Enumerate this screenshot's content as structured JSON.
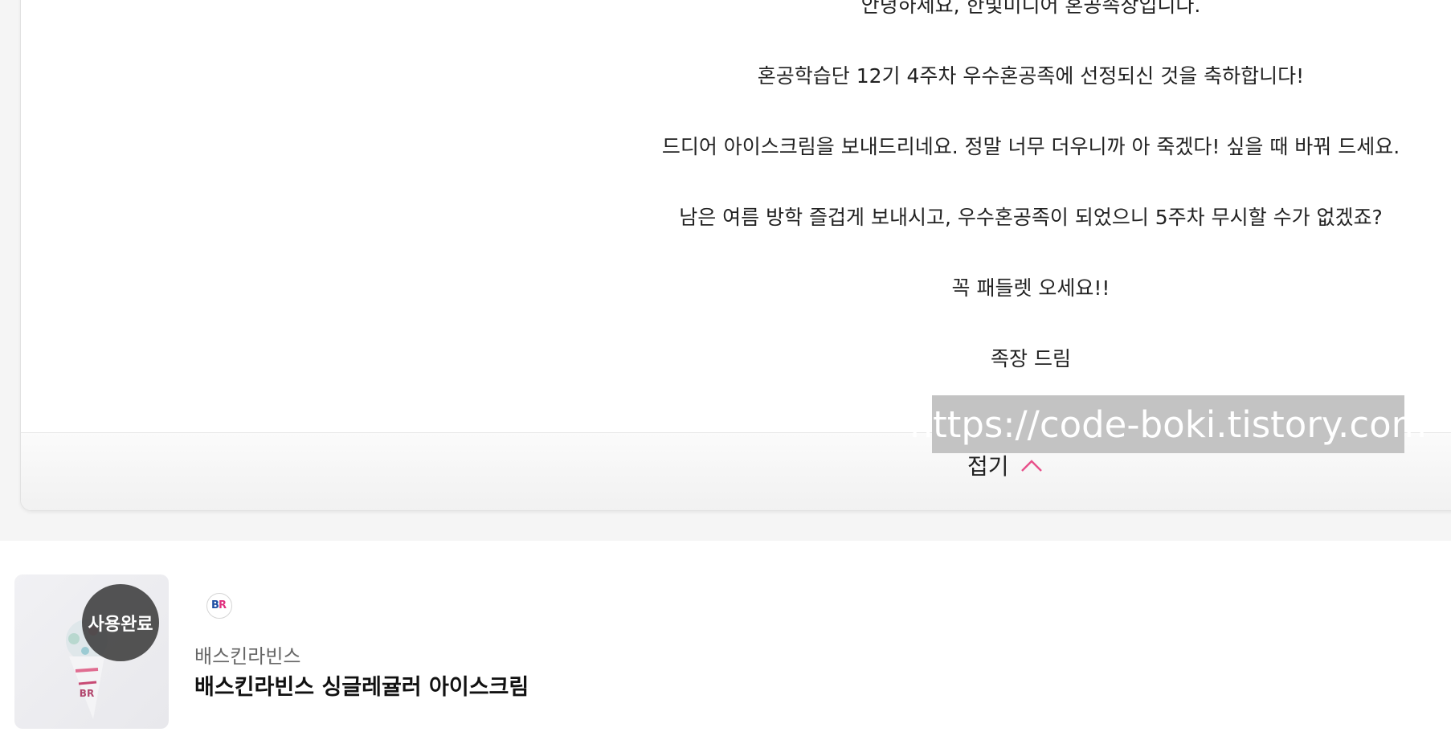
{
  "message": {
    "lines": [
      "안녕하세요, 한빛미디어 혼공족장입니다.",
      "혼공학습단 12기 4주차 우수혼공족에 선정되신 것을 축하합니다!",
      "드디어 아이스크림을 보내드리네요. 정말 너무 더우니까 아 죽겠다! 싶을 때 바꿔 드세요.",
      "남은 여름 방학 즐겁게 보내시고, 우수혼공족이 되었으니 5주차 무시할 수가 없겠죠?",
      "꼭 패들렛 오세요!!",
      "족장 드림"
    ]
  },
  "fold": {
    "label": "접기",
    "icon": "chevron-up-icon",
    "accent_color": "#e84f8a"
  },
  "watermark": {
    "text": "https://code-boki.tistory.com"
  },
  "product": {
    "badge": "사용완료",
    "brand_logo_icon": "baskin-robbins-logo",
    "brand": "배스킨라빈스",
    "name": "배스킨라빈스 싱글레귤러 아이스크림"
  }
}
